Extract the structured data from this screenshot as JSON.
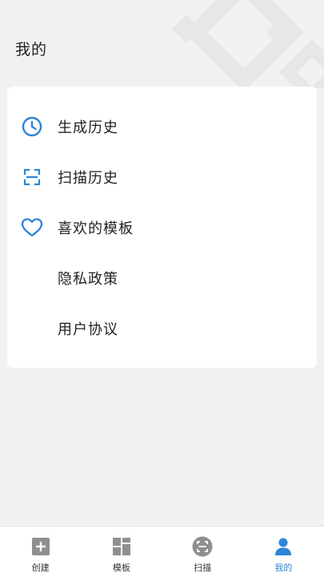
{
  "header": {
    "title": "我的"
  },
  "menu": {
    "items": [
      {
        "label": "生成历史",
        "icon": "clock-icon"
      },
      {
        "label": "扫描历史",
        "icon": "scan-frame-icon"
      },
      {
        "label": "喜欢的模板",
        "icon": "heart-icon"
      },
      {
        "label": "隐私政策",
        "icon": ""
      },
      {
        "label": "用户协议",
        "icon": ""
      }
    ]
  },
  "tabbar": {
    "tabs": [
      {
        "label": "创建",
        "icon": "plus-square-icon",
        "active": false
      },
      {
        "label": "模板",
        "icon": "template-grid-icon",
        "active": false
      },
      {
        "label": "扫描",
        "icon": "scan-circle-icon",
        "active": false
      },
      {
        "label": "我的",
        "icon": "user-icon",
        "active": true
      }
    ]
  },
  "colors": {
    "accent": "#2b86d9",
    "background": "#f1f1f4",
    "card": "#ffffff",
    "text": "#222222",
    "inactive_icon": "#8f8f8f"
  }
}
